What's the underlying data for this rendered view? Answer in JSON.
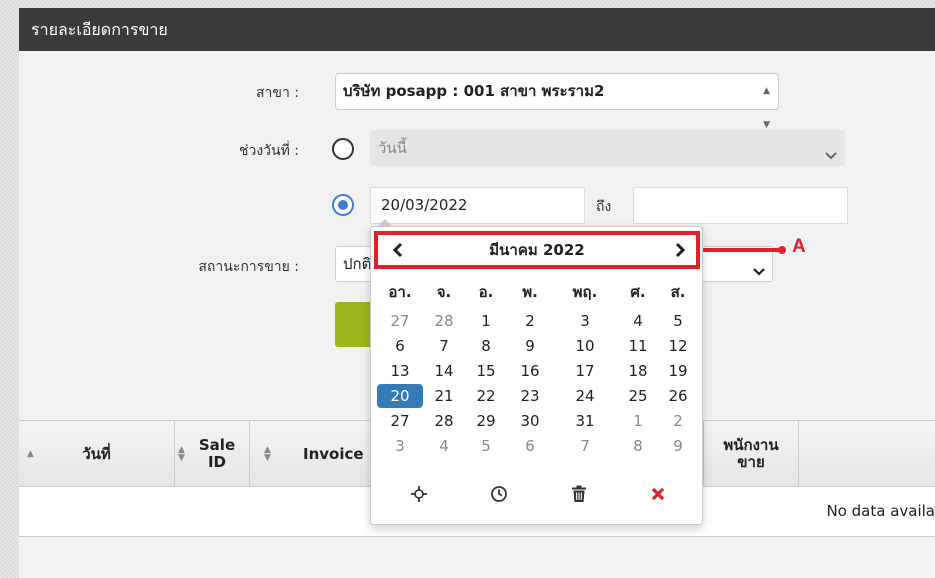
{
  "panel": {
    "title": "รายละเอียดการขาย"
  },
  "form": {
    "branch_label": "สาขา :",
    "branch_value": "บริษัท posapp : 001 สาขา พระราม2",
    "date_range_label": "ช่วงวันที่ :",
    "preset_value": "วันนี้",
    "from_date": "20/03/2022",
    "to_label": "ถึง",
    "to_date": "",
    "status_label": "สถานะการขาย :",
    "status_value": "ปกติ"
  },
  "datepicker": {
    "month_title": "มีนาคม 2022",
    "weekdays": [
      "อา.",
      "จ.",
      "อ.",
      "พ.",
      "พฤ.",
      "ศ.",
      "ส."
    ],
    "weeks": [
      [
        "27",
        "28",
        "1",
        "2",
        "3",
        "4",
        "5"
      ],
      [
        "6",
        "7",
        "8",
        "9",
        "10",
        "11",
        "12"
      ],
      [
        "13",
        "14",
        "15",
        "16",
        "17",
        "18",
        "19"
      ],
      [
        "20",
        "21",
        "22",
        "23",
        "24",
        "25",
        "26"
      ],
      [
        "27",
        "28",
        "29",
        "30",
        "31",
        "1",
        "2"
      ],
      [
        "3",
        "4",
        "5",
        "6",
        "7",
        "8",
        "9"
      ]
    ],
    "muted": [
      [
        0,
        0
      ],
      [
        0,
        1
      ],
      [
        4,
        5
      ],
      [
        4,
        6
      ],
      [
        5,
        0
      ],
      [
        5,
        1
      ],
      [
        5,
        2
      ],
      [
        5,
        3
      ],
      [
        5,
        4
      ],
      [
        5,
        5
      ],
      [
        5,
        6
      ]
    ],
    "selected": [
      3,
      0
    ],
    "tools": [
      "crosshair-icon",
      "clock-icon",
      "trash-icon",
      "close-icon"
    ]
  },
  "annotation": {
    "label": "A",
    "color": "#e0202a"
  },
  "table": {
    "columns": [
      "วันที่",
      "Sale ID",
      "Invoice ID",
      "พนักงาน ขาย"
    ],
    "empty_text": "No data availa"
  },
  "colors": {
    "accent": "#337ab7",
    "header_bg": "#3b3b3b",
    "search_button": "#9cb51a"
  }
}
